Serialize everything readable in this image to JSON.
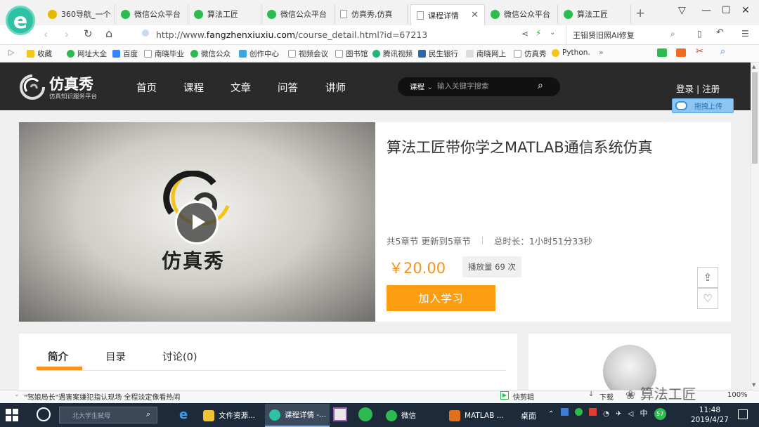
{
  "browser": {
    "logo": "e",
    "tabs": [
      {
        "label": "360导航_一个",
        "icon": "y"
      },
      {
        "label": "微信公众平台",
        "icon": "g"
      },
      {
        "label": "算法工匠",
        "icon": "g"
      },
      {
        "label": "微信公众平台",
        "icon": "g"
      },
      {
        "label": "仿真秀,仿真",
        "icon": "d"
      },
      {
        "label": "课程详情",
        "icon": "d"
      },
      {
        "label": "微信公众平台",
        "icon": "g"
      },
      {
        "label": "算法工匠",
        "icon": "g"
      }
    ],
    "new_tab": "+",
    "url_prefix": "http://www.",
    "url_domain": "fangzhenxiuxiu.com",
    "url_path": "/course_detail.html?id=67213",
    "address_search": "王钼贤旧照AI修复",
    "bookmarks": [
      "收藏",
      "网址大全",
      "百度",
      "南晓毕业",
      "微信公众",
      "创作中心",
      "视频会议",
      "图书馆",
      "腾讯视频",
      "民生银行",
      "南晓网上",
      "仿真秀",
      "Python."
    ]
  },
  "site": {
    "logo_name": "仿真秀",
    "logo_sub": "仿真知识服务平台",
    "nav": [
      "首页",
      "课程",
      "文章",
      "问答",
      "讲师"
    ],
    "search_category": "课程",
    "search_placeholder": "输入关键字搜索",
    "login": "登录",
    "divider": "|",
    "register": "注册",
    "upload": "拖拽上传"
  },
  "course": {
    "video_brand": "仿真秀",
    "title": "算法工匠带你学之MATLAB通信系统仿真",
    "chapters": "共5章节",
    "updated": "更新到5章节",
    "duration": "总时长：1小时51分33秒",
    "price": "￥20.00",
    "plays": "播放量 69 次",
    "enroll": "加入学习"
  },
  "panel_tabs": [
    "简介",
    "目录",
    "讨论(0)"
  ],
  "status": {
    "news": "\"驾娘局长\"遇害案嫌犯指认现场 全程淡定像看热闹",
    "items": [
      "快剪辑",
      "下载"
    ],
    "zoom": "100%"
  },
  "watermark": "算法工匠",
  "taskbar": {
    "search": "北大学生弑母",
    "apps": [
      "文件资源...",
      "课程详情 -...",
      "微信",
      "MATLAB ..."
    ],
    "desktop": "桌面",
    "ime": "中",
    "badge": "57",
    "time": "11:48",
    "date": "2019/4/27"
  }
}
